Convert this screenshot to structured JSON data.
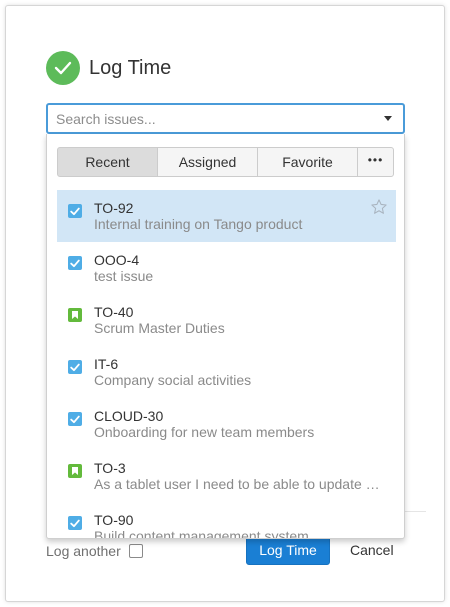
{
  "dialog": {
    "title": "Log Time"
  },
  "search": {
    "placeholder": "Search issues...",
    "value": ""
  },
  "tabs": [
    {
      "label": "Recent",
      "active": true
    },
    {
      "label": "Assigned",
      "active": false
    },
    {
      "label": "Favorite",
      "active": false
    },
    {
      "label": "•••",
      "active": false
    }
  ],
  "issues": [
    {
      "key": "TO-92",
      "summary": "Internal training on Tango product",
      "type": "task",
      "selected": true
    },
    {
      "key": "OOO-4",
      "summary": "test issue",
      "type": "task",
      "selected": false
    },
    {
      "key": "TO-40",
      "summary": "Scrum Master Duties",
      "type": "story",
      "selected": false
    },
    {
      "key": "IT-6",
      "summary": "Company social activities",
      "type": "task",
      "selected": false
    },
    {
      "key": "CLOUD-30",
      "summary": "Onboarding for new team members",
      "type": "task",
      "selected": false
    },
    {
      "key": "TO-3",
      "summary": "As a tablet user I need to be able to update …",
      "type": "story",
      "selected": false
    },
    {
      "key": "TO-90",
      "summary": "Build content management system",
      "type": "task",
      "selected": false
    }
  ],
  "footer": {
    "log_another_label": "Log another",
    "submit_label": "Log Time",
    "cancel_label": "Cancel"
  },
  "colors": {
    "success_green": "#5dbb5a",
    "primary_blue": "#1a7fd4",
    "selected_row": "#d2e6f6",
    "task_icon": "#4fade6",
    "story_icon": "#63ba3c"
  },
  "icons": {
    "header": "check-circle-icon",
    "task": "checkbox-task-icon",
    "story": "bookmark-story-icon",
    "favorite": "star-icon",
    "dropdown": "chevron-down-icon"
  }
}
